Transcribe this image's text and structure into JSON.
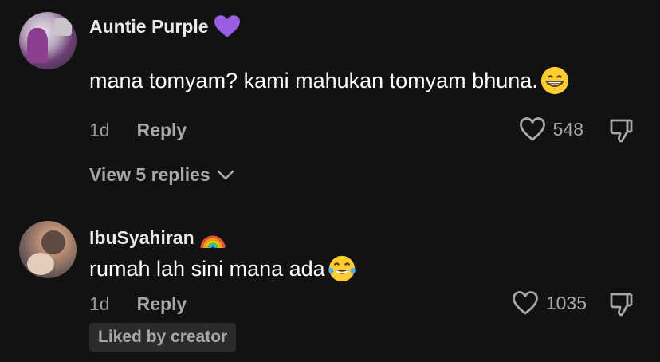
{
  "comments": [
    {
      "username": "Auntie Purple",
      "username_emoji": "purple-heart",
      "text": "mana tomyam? kami mahukan tomyam bhuna.",
      "text_emoji": "grinning-face",
      "age": "1d",
      "reply_label": "Reply",
      "likes": "548",
      "view_replies": "View 5 replies"
    },
    {
      "username": "IbuSyahiran",
      "username_emoji": "rainbow",
      "text": "rumah lah sini mana ada",
      "text_emoji": "face-with-tears-of-joy",
      "age": "1d",
      "reply_label": "Reply",
      "likes": "1035",
      "badge": "Liked by creator"
    }
  ],
  "colors": {
    "background": "#121212",
    "secondary_text": "#a8a8a8",
    "badge_bg": "#2b2b2b"
  }
}
